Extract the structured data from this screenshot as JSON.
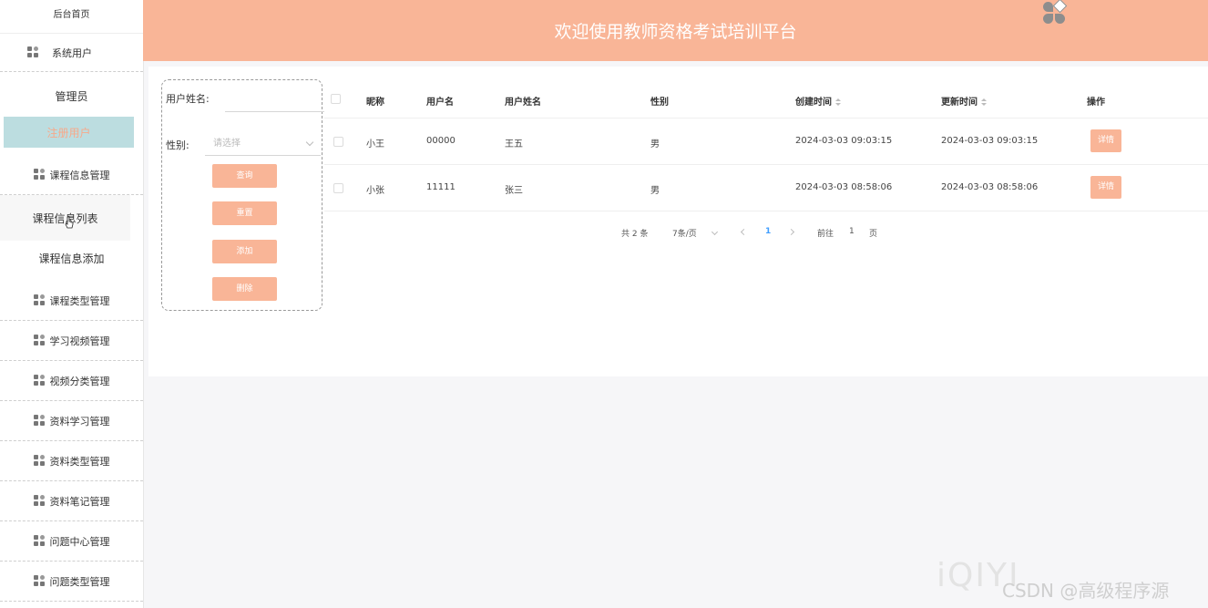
{
  "sidebar": {
    "home": "后台首页",
    "groups": [
      {
        "label": "系统用户",
        "icon": "menu-grid-icon"
      },
      {
        "label": "课程信息管理",
        "icon": "menu-grid-icon"
      },
      {
        "label": "课程类型管理",
        "icon": "menu-grid-icon"
      },
      {
        "label": "学习视频管理",
        "icon": "menu-grid-icon"
      },
      {
        "label": "视频分类管理",
        "icon": "menu-grid-icon"
      },
      {
        "label": "资料学习管理",
        "icon": "menu-grid-icon"
      },
      {
        "label": "资料类型管理",
        "icon": "menu-grid-icon"
      },
      {
        "label": "资料笔记管理",
        "icon": "menu-grid-icon"
      },
      {
        "label": "问题中心管理",
        "icon": "menu-grid-icon"
      },
      {
        "label": "问题类型管理",
        "icon": "menu-grid-icon"
      }
    ],
    "system_user_items": [
      "管理员",
      "注册用户"
    ],
    "course_items": [
      "课程信息列表",
      "课程信息添加"
    ]
  },
  "header": {
    "title": "欢迎使用教师资格考试培训平台",
    "avatar_icon": "avatar-icon"
  },
  "filter": {
    "name_label": "用户姓名:",
    "name_value": "",
    "gender_label": "性别:",
    "gender_placeholder": "请选择",
    "buttons": [
      "查询",
      "重置",
      "添加",
      "删除"
    ]
  },
  "table": {
    "headers": [
      "昵称",
      "用户名",
      "用户姓名",
      "性别",
      "创建时间",
      "更新时间",
      "操作"
    ],
    "rows": [
      {
        "nickname": "小王",
        "username": "00000",
        "realname": "王五",
        "gender": "男",
        "created": "2024-03-03 09:03:15",
        "updated": "2024-03-03 09:03:15",
        "action": "详情"
      },
      {
        "nickname": "小张",
        "username": "11111",
        "realname": "张三",
        "gender": "男",
        "created": "2024-03-03 08:58:06",
        "updated": "2024-03-03 08:58:06",
        "action": "详情"
      }
    ]
  },
  "pagination": {
    "total": "共 2 条",
    "page_size": "7条/页",
    "current_page": "1",
    "goto_label": "前往",
    "goto_value": "1",
    "page_suffix": "页"
  },
  "watermark": {
    "iqiyi": "iQIYI",
    "csdn": "CSDN @高级程序源"
  },
  "colors": {
    "accent": "#f9b597",
    "active_bg": "#bcdde0",
    "page_bg": "#f6f6f8"
  }
}
